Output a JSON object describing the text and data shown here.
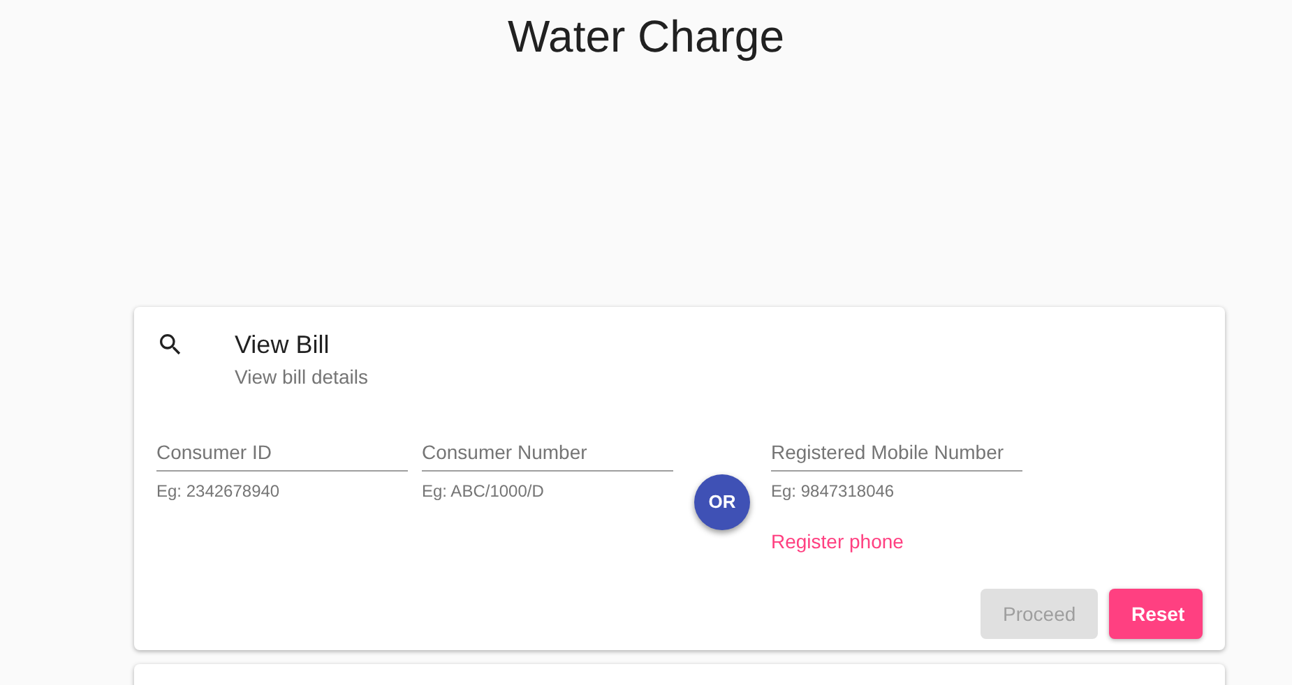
{
  "page": {
    "title": "Water Charge"
  },
  "card": {
    "title": "View Bill",
    "subtitle": "View bill details",
    "fields": [
      {
        "placeholder": "Consumer ID",
        "hint": "Eg: 2342678940"
      },
      {
        "placeholder": "Consumer Number",
        "hint": "Eg: ABC/1000/D"
      }
    ],
    "separator": "OR",
    "mobile_field": {
      "placeholder": "Registered Mobile Number",
      "hint": "Eg: 9847318046"
    },
    "link": "Register phone",
    "buttons": [
      {
        "label": "Proceed",
        "disabled": true,
        "kind": "secondary"
      },
      {
        "label": "Reset",
        "disabled": false,
        "kind": "primary"
      }
    ]
  }
}
